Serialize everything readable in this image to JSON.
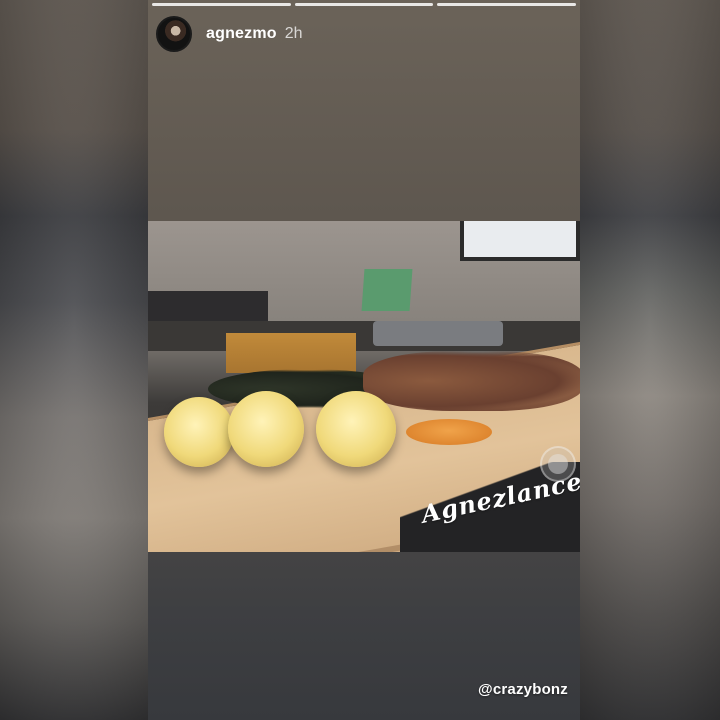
{
  "story": {
    "username": "agnezmo",
    "time_ago": "2h",
    "progress_segments": 3,
    "photo": {
      "signature_text": "Agnezlance",
      "subject": "Plated food on wooden cutting board"
    },
    "mention": "@crazybonz"
  },
  "icons": {
    "avatar": "profile-avatar",
    "badge": "circle-badge-icon"
  }
}
